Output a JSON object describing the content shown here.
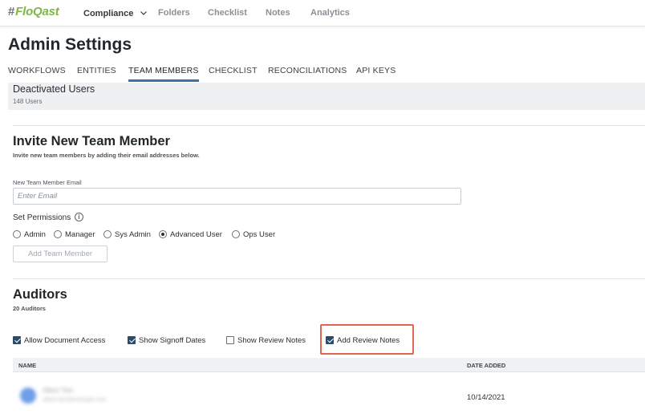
{
  "nav": {
    "logo_hash": "#",
    "logo_text": "FloQast",
    "items": [
      {
        "label": "Compliance",
        "active": true,
        "icon": "chevron-down-icon"
      },
      {
        "label": "Folders"
      },
      {
        "label": "Checklist"
      },
      {
        "label": "Notes"
      },
      {
        "label": "Analytics"
      }
    ]
  },
  "page": {
    "title": "Admin Settings"
  },
  "tabs": [
    {
      "label": "WORKFLOWS"
    },
    {
      "label": "ENTITIES"
    },
    {
      "label": "TEAM MEMBERS",
      "active": true
    },
    {
      "label": "CHECKLIST"
    },
    {
      "label": "RECONCILIATIONS"
    },
    {
      "label": "API KEYS"
    }
  ],
  "deactivated": {
    "title": "Deactivated Users",
    "count": "148 Users"
  },
  "invite": {
    "title": "Invite New Team Member",
    "subtitle": "Invite new team members by adding their email addresses below.",
    "email_label": "New Team Member Email",
    "email_placeholder": "Enter Email",
    "email_value": "",
    "permissions_label": "Set Permissions",
    "info_icon": "i",
    "roles": [
      {
        "label": "Admin",
        "checked": false
      },
      {
        "label": "Manager",
        "checked": false
      },
      {
        "label": "Sys Admin",
        "checked": false
      },
      {
        "label": "Advanced User",
        "checked": true
      },
      {
        "label": "Ops User",
        "checked": false
      }
    ],
    "add_button": "Add Team Member"
  },
  "auditors": {
    "title": "Auditors",
    "count": "20 Auditors",
    "options": [
      {
        "label": "Allow Document Access",
        "checked": true
      },
      {
        "label": "Show Signoff Dates",
        "checked": true
      },
      {
        "label": "Show Review Notes",
        "checked": false
      },
      {
        "label": "Add Review Notes",
        "checked": true
      }
    ],
    "highlight_color": "#e0664f",
    "columns": {
      "name": "NAME",
      "date": "DATE ADDED"
    },
    "rows": [
      {
        "name": "Albert Tien",
        "email": "albert.tien@example.com",
        "date": "10/14/2021"
      }
    ]
  },
  "colors": {
    "accent": "#3f6fa3",
    "logo_green": "#7fb548",
    "checkbox_fill": "#2d4a6b"
  }
}
